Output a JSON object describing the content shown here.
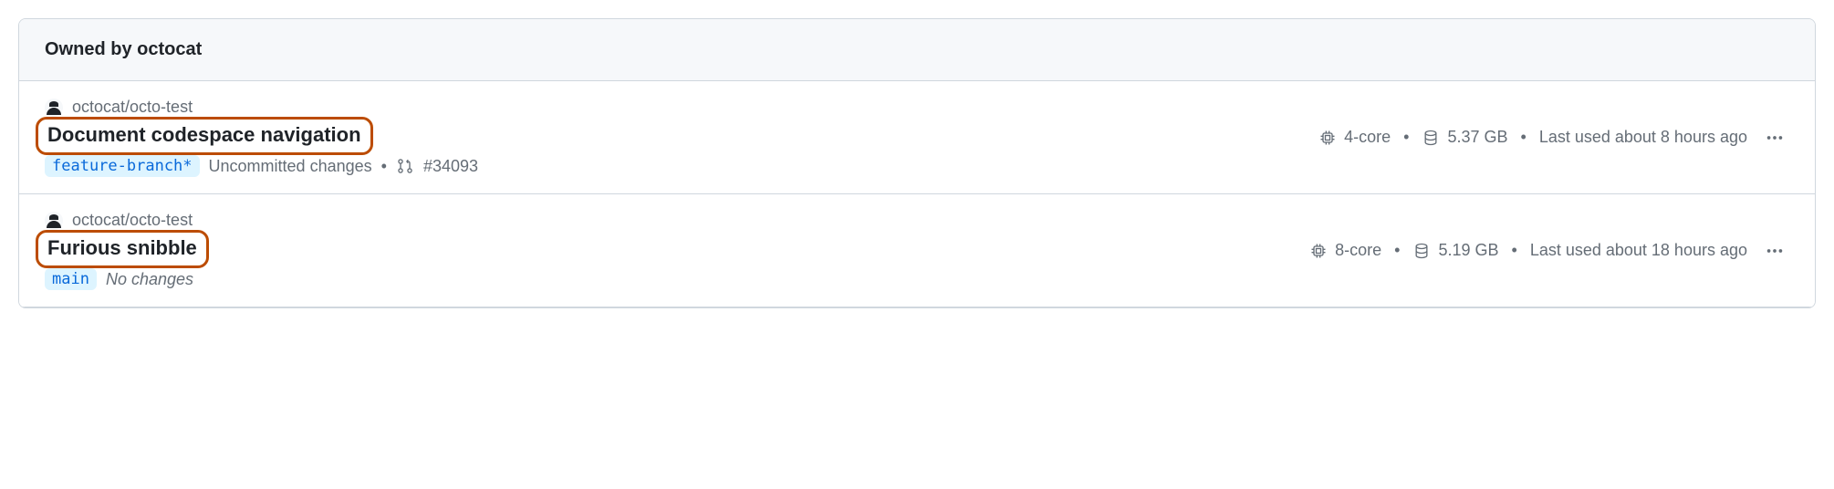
{
  "header": {
    "title": "Owned by octocat"
  },
  "rows": [
    {
      "repo": "octocat/octo-test",
      "title": "Document codespace navigation",
      "branch": "feature-branch*",
      "changes": "Uncommitted changes",
      "changes_italic": false,
      "pr": "#34093",
      "cores": "4-core",
      "storage": "5.37 GB",
      "last_used": "Last used about 8 hours ago"
    },
    {
      "repo": "octocat/octo-test",
      "title": "Furious snibble",
      "branch": "main",
      "changes": "No changes",
      "changes_italic": true,
      "pr": "",
      "cores": "8-core",
      "storage": "5.19 GB",
      "last_used": "Last used about 18 hours ago"
    }
  ]
}
